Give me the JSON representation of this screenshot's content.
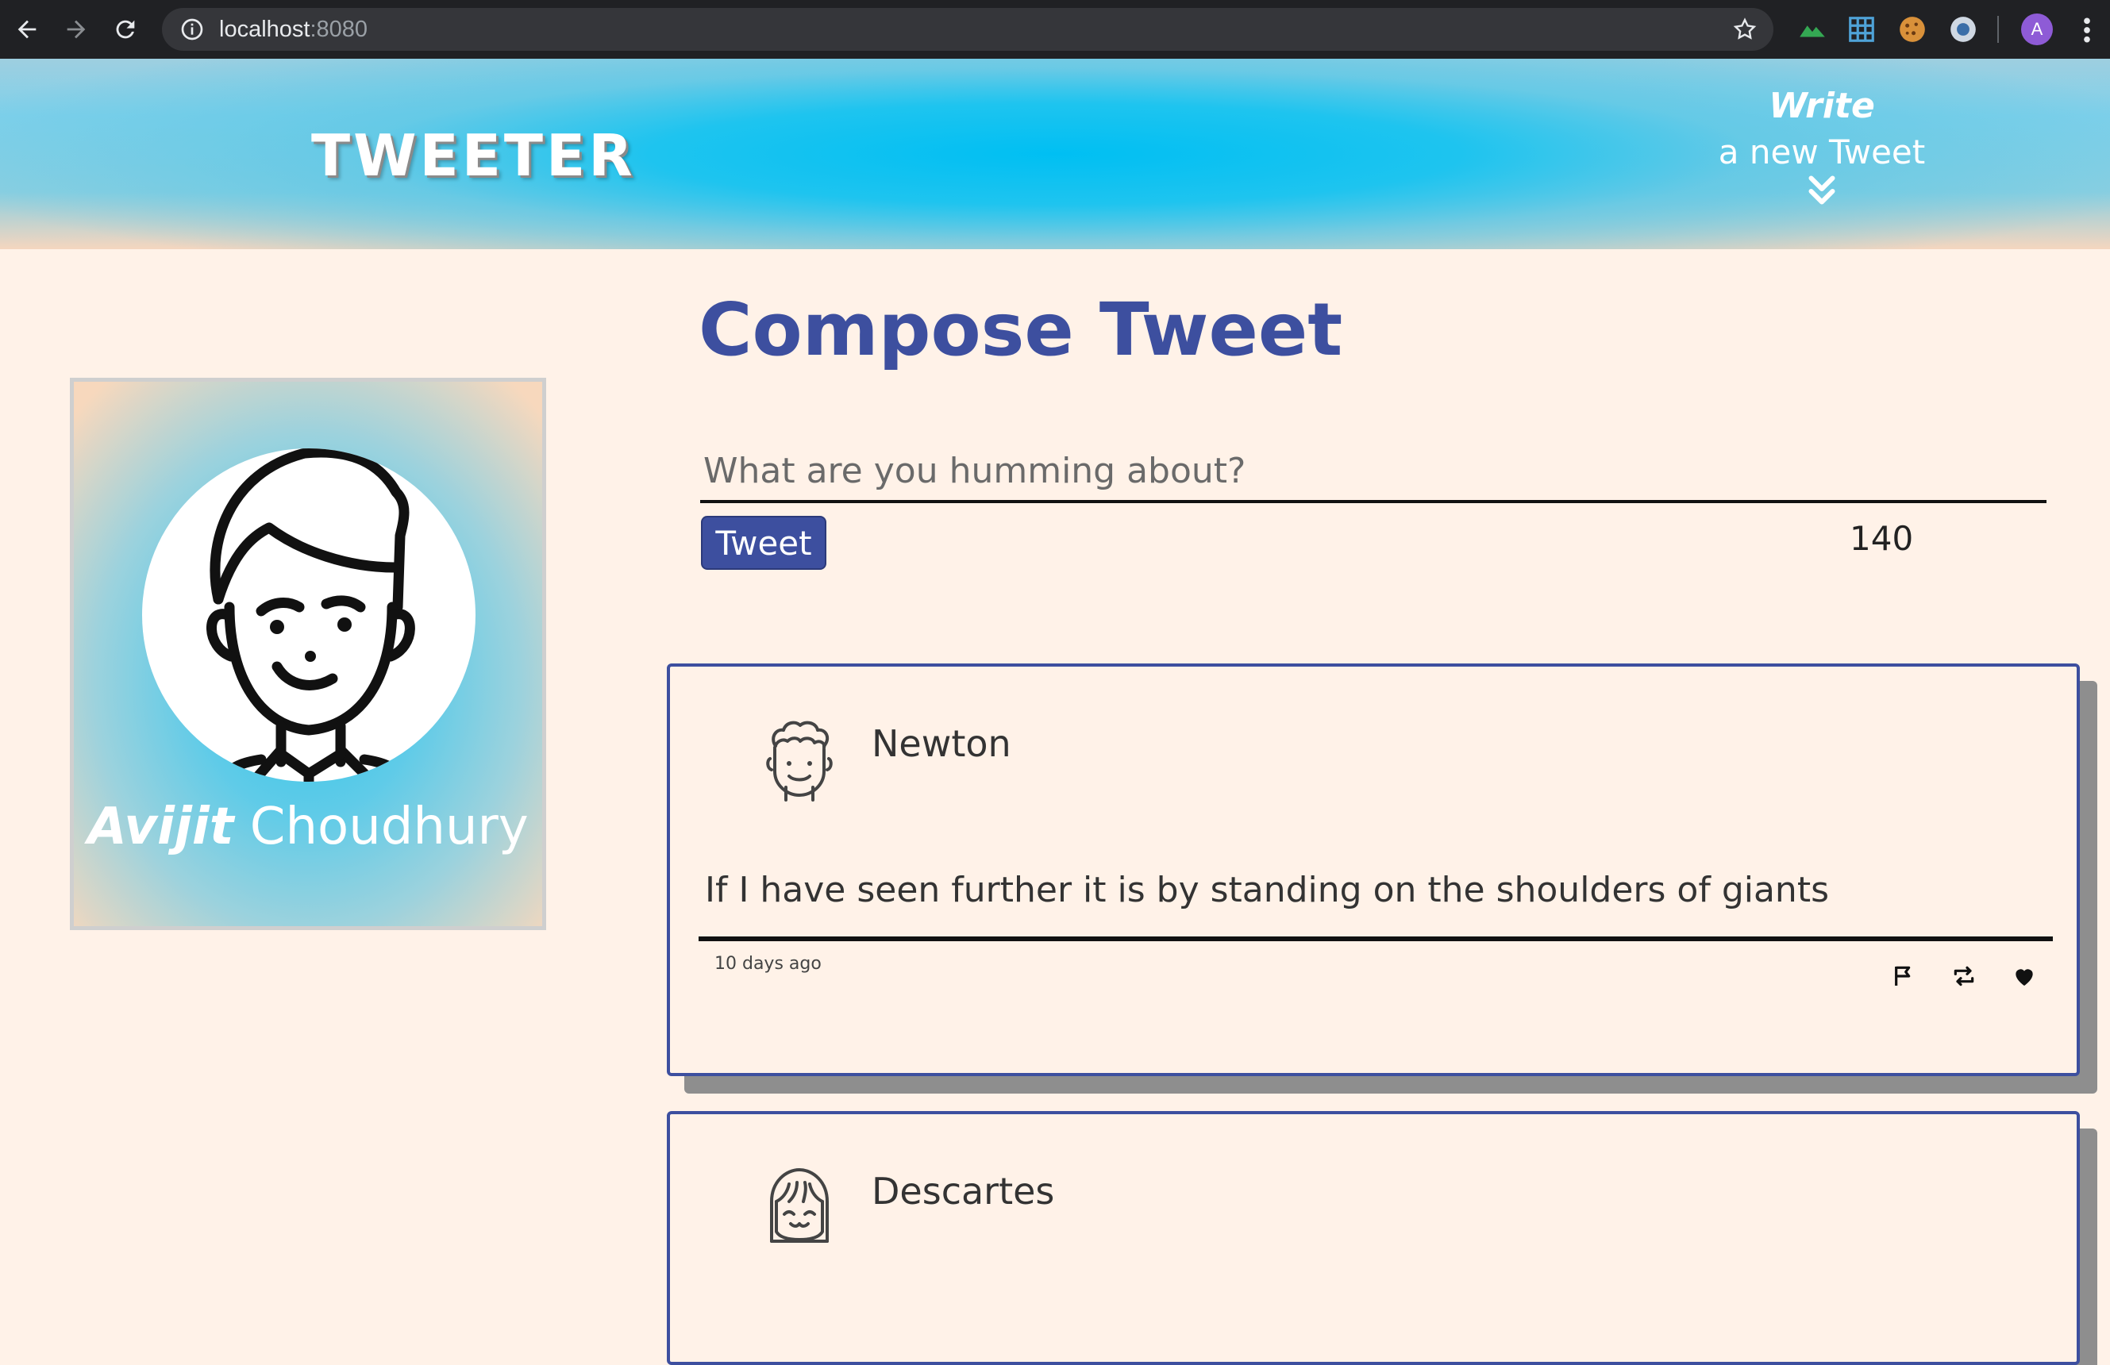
{
  "browser": {
    "url_host": "localhost",
    "url_port": ":8080",
    "profile_initial": "A"
  },
  "header": {
    "logo": "TWEETER",
    "write_toggle": {
      "line1": "Write",
      "line2": "a new Tweet"
    }
  },
  "profile": {
    "first_name": "Avijit",
    "last_name": "Choudhury"
  },
  "compose": {
    "title": "Compose Tweet",
    "placeholder": "What are you humming about?",
    "value": "",
    "button_label": "Tweet",
    "counter": "140"
  },
  "tweets": [
    {
      "name": "Newton",
      "content": "If I have seen further it is by standing on the shoulders of giants",
      "date": "10 days ago",
      "avatar_icon": "curly-hair-avatar-icon"
    },
    {
      "name": "Descartes",
      "content": "",
      "date": "",
      "avatar_icon": "bangs-hair-avatar-icon"
    }
  ],
  "colors": {
    "accent": "#3d4f9f",
    "page_bg": "#fff2e8",
    "header_center": "#00bff3"
  }
}
